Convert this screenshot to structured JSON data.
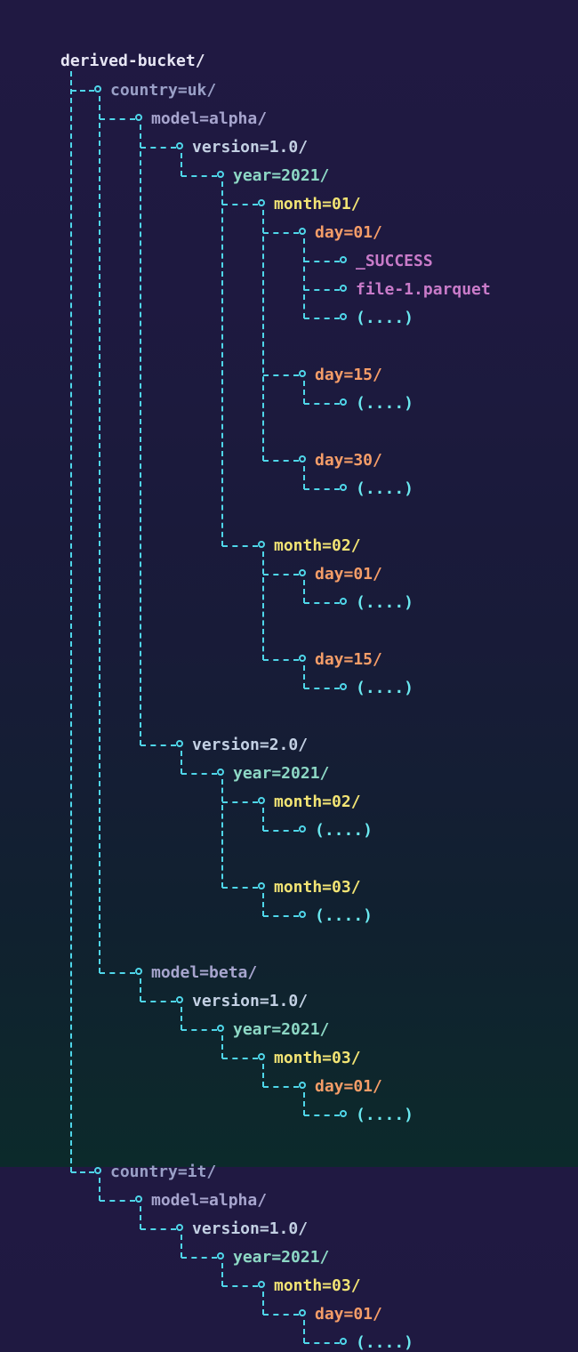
{
  "colors": {
    "line": "#4fd6e9",
    "root": "#e7e6f4",
    "country": "#9aa0c7",
    "model": "#a7a5ce",
    "version": "#c3d0e3",
    "year": "#8dd8c5",
    "month": "#f2e474",
    "day": "#f59d68",
    "file": "#c97bc9",
    "ellipsis": "#6be8ef"
  },
  "tree": {
    "label": "derived-bucket/",
    "kind": "root",
    "children": [
      {
        "label": "country=uk/",
        "kind": "country",
        "children": [
          {
            "label": "model=alpha/",
            "kind": "model",
            "children": [
              {
                "label": "version=1.0/",
                "kind": "version",
                "children": [
                  {
                    "label": "year=2021/",
                    "kind": "year",
                    "children": [
                      {
                        "label": "month=01/",
                        "kind": "month",
                        "children": [
                          {
                            "label": "day=01/",
                            "kind": "day",
                            "children": [
                              {
                                "label": "_SUCCESS",
                                "kind": "file"
                              },
                              {
                                "label": "file-1.parquet",
                                "kind": "file"
                              },
                              {
                                "label": "(....)",
                                "kind": "ellipsis"
                              }
                            ],
                            "gapAfter": 1
                          },
                          {
                            "label": "day=15/",
                            "kind": "day",
                            "children": [
                              {
                                "label": "(....)",
                                "kind": "ellipsis"
                              }
                            ],
                            "gapAfter": 1
                          },
                          {
                            "label": "day=30/",
                            "kind": "day",
                            "children": [
                              {
                                "label": "(....)",
                                "kind": "ellipsis"
                              }
                            ]
                          }
                        ],
                        "gapAfter": 1
                      },
                      {
                        "label": "month=02/",
                        "kind": "month",
                        "children": [
                          {
                            "label": "day=01/",
                            "kind": "day",
                            "children": [
                              {
                                "label": "(....)",
                                "kind": "ellipsis"
                              }
                            ],
                            "gapAfter": 1
                          },
                          {
                            "label": "day=15/",
                            "kind": "day",
                            "children": [
                              {
                                "label": "(....)",
                                "kind": "ellipsis"
                              }
                            ]
                          }
                        ]
                      }
                    ]
                  }
                ],
                "gapAfter": 1
              },
              {
                "label": "version=2.0/",
                "kind": "version",
                "children": [
                  {
                    "label": "year=2021/",
                    "kind": "year",
                    "children": [
                      {
                        "label": "month=02/",
                        "kind": "month",
                        "children": [
                          {
                            "label": "(....)",
                            "kind": "ellipsis"
                          }
                        ],
                        "gapAfter": 1
                      },
                      {
                        "label": "month=03/",
                        "kind": "month",
                        "children": [
                          {
                            "label": "(....)",
                            "kind": "ellipsis"
                          }
                        ]
                      }
                    ]
                  }
                ]
              }
            ],
            "gapAfter": 1
          },
          {
            "label": "model=beta/",
            "kind": "model",
            "children": [
              {
                "label": "version=1.0/",
                "kind": "version",
                "children": [
                  {
                    "label": "year=2021/",
                    "kind": "year",
                    "children": [
                      {
                        "label": "month=03/",
                        "kind": "month",
                        "children": [
                          {
                            "label": "day=01/",
                            "kind": "day",
                            "children": [
                              {
                                "label": "(....)",
                                "kind": "ellipsis"
                              }
                            ]
                          }
                        ]
                      }
                    ]
                  }
                ]
              }
            ]
          }
        ],
        "gapAfter": 1
      },
      {
        "label": "country=it/",
        "kind": "country",
        "children": [
          {
            "label": "model=alpha/",
            "kind": "model",
            "children": [
              {
                "label": "version=1.0/",
                "kind": "version",
                "children": [
                  {
                    "label": "year=2021/",
                    "kind": "year",
                    "children": [
                      {
                        "label": "month=03/",
                        "kind": "month",
                        "children": [
                          {
                            "label": "day=01/",
                            "kind": "day",
                            "children": [
                              {
                                "label": "(....)",
                                "kind": "ellipsis"
                              }
                            ]
                          }
                        ]
                      }
                    ]
                  }
                ]
              }
            ]
          }
        ]
      }
    ]
  }
}
